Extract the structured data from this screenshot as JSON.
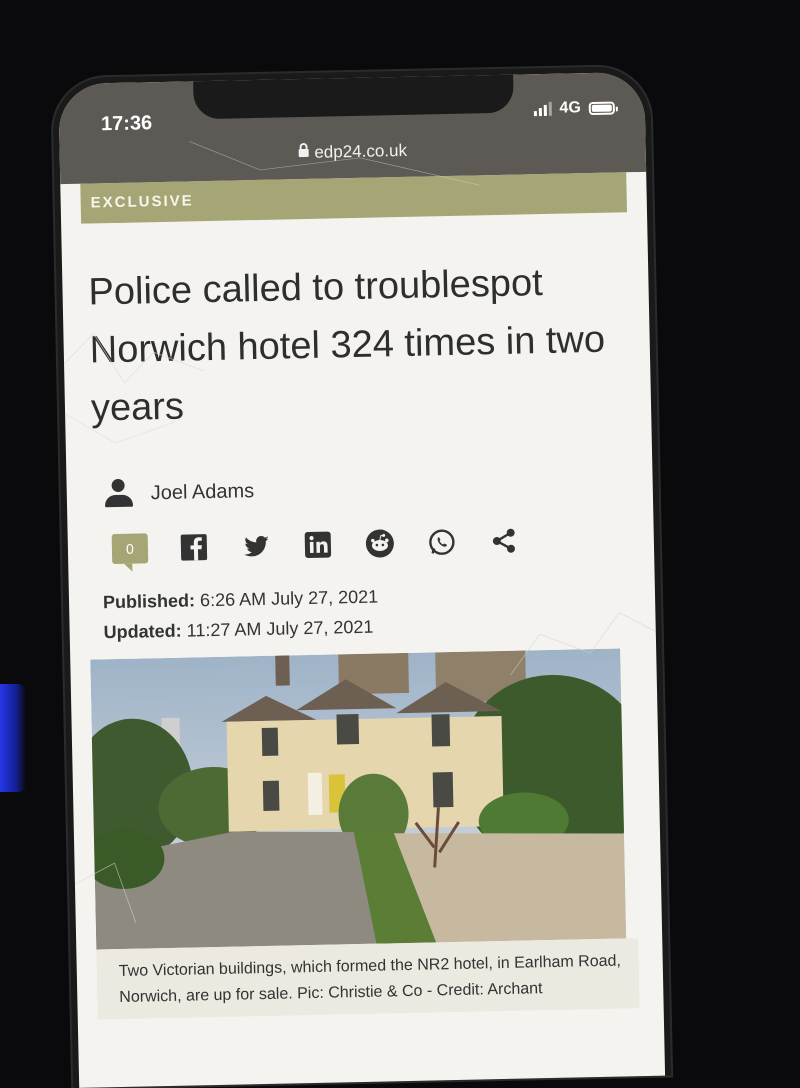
{
  "status_bar": {
    "time": "17:36",
    "network": "4G"
  },
  "browser": {
    "url": "edp24.co.uk"
  },
  "article": {
    "tag": "EXCLUSIVE",
    "headline": "Police called to troublespot Norwich hotel 324 times in two years",
    "author": "Joel Adams",
    "comment_count": "0",
    "published_label": "Published:",
    "published_value": "6:26 AM July 27, 2021",
    "updated_label": "Updated:",
    "updated_value": "11:27 AM July 27, 2021",
    "image_caption": "Two Victorian buildings, which formed the NR2 hotel, in Earlham Road, Norwich, are up for sale. Pic: Christie & Co - Credit: Archant"
  },
  "share_icons": [
    "facebook-icon",
    "twitter-icon",
    "linkedin-icon",
    "reddit-icon",
    "whatsapp-icon",
    "share-icon"
  ],
  "colors": {
    "tag_bg": "#a6a575",
    "chrome": "#5d5a55",
    "text": "#2e2e2e"
  }
}
